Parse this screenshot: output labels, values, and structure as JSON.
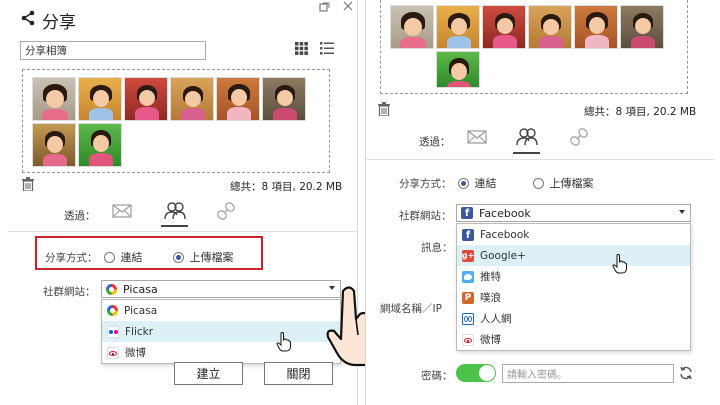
{
  "left": {
    "title": "分享",
    "album_name": "分享相簿",
    "total": "總共：8 項目, 20.2 MB",
    "via_label": "透過：",
    "share_method_label": "分享方式：",
    "method_link": "連結",
    "method_upload": "上傳檔案",
    "selected_method": "上傳檔案",
    "social_label": "社群網站：",
    "social_selected": "Picasa",
    "social_options": [
      "Picasa",
      "Flickr",
      "微博"
    ],
    "hovered_option": "Flickr",
    "btn_create": "建立",
    "btn_close": "關閉"
  },
  "right": {
    "total": "總共：8 項目, 20.2 MB",
    "via_label": "透過：",
    "share_method_label": "分享方式：",
    "method_link": "連結",
    "method_upload": "上傳檔案",
    "selected_method": "連結",
    "social_label": "社群網站：",
    "social_selected": "Facebook",
    "message_label": "訊息：",
    "domain_label": "網域名稱／IP",
    "social_options": [
      "Facebook",
      "Google+",
      "推特",
      "噗浪",
      "人人網",
      "微博"
    ],
    "hovered_option": "Google+",
    "password_label": "密碼：",
    "password_placeholder": "請輸入密碼。",
    "password_enabled": true
  },
  "colors": {
    "highlight_border": "#c8232c",
    "dropdown_hover": "#dcf0f5",
    "toggle_on": "#4cc24a",
    "facebook": "#3b5998",
    "googleplus": "#dd4b39",
    "twitter": "#55acee",
    "plurk": "#cf682f",
    "renren": "#2266b3",
    "weibo": "#e6162d",
    "flickr_pink": "#ff0084",
    "flickr_blue": "#0063dc"
  },
  "icons": {
    "title": "share-icon",
    "grid_view": "grid-icon",
    "list_view": "list-icon",
    "delete": "trash-icon",
    "via_email": "envelope-icon",
    "via_social": "people-icon",
    "via_link": "link-icon",
    "refresh_password": "refresh-icon"
  }
}
